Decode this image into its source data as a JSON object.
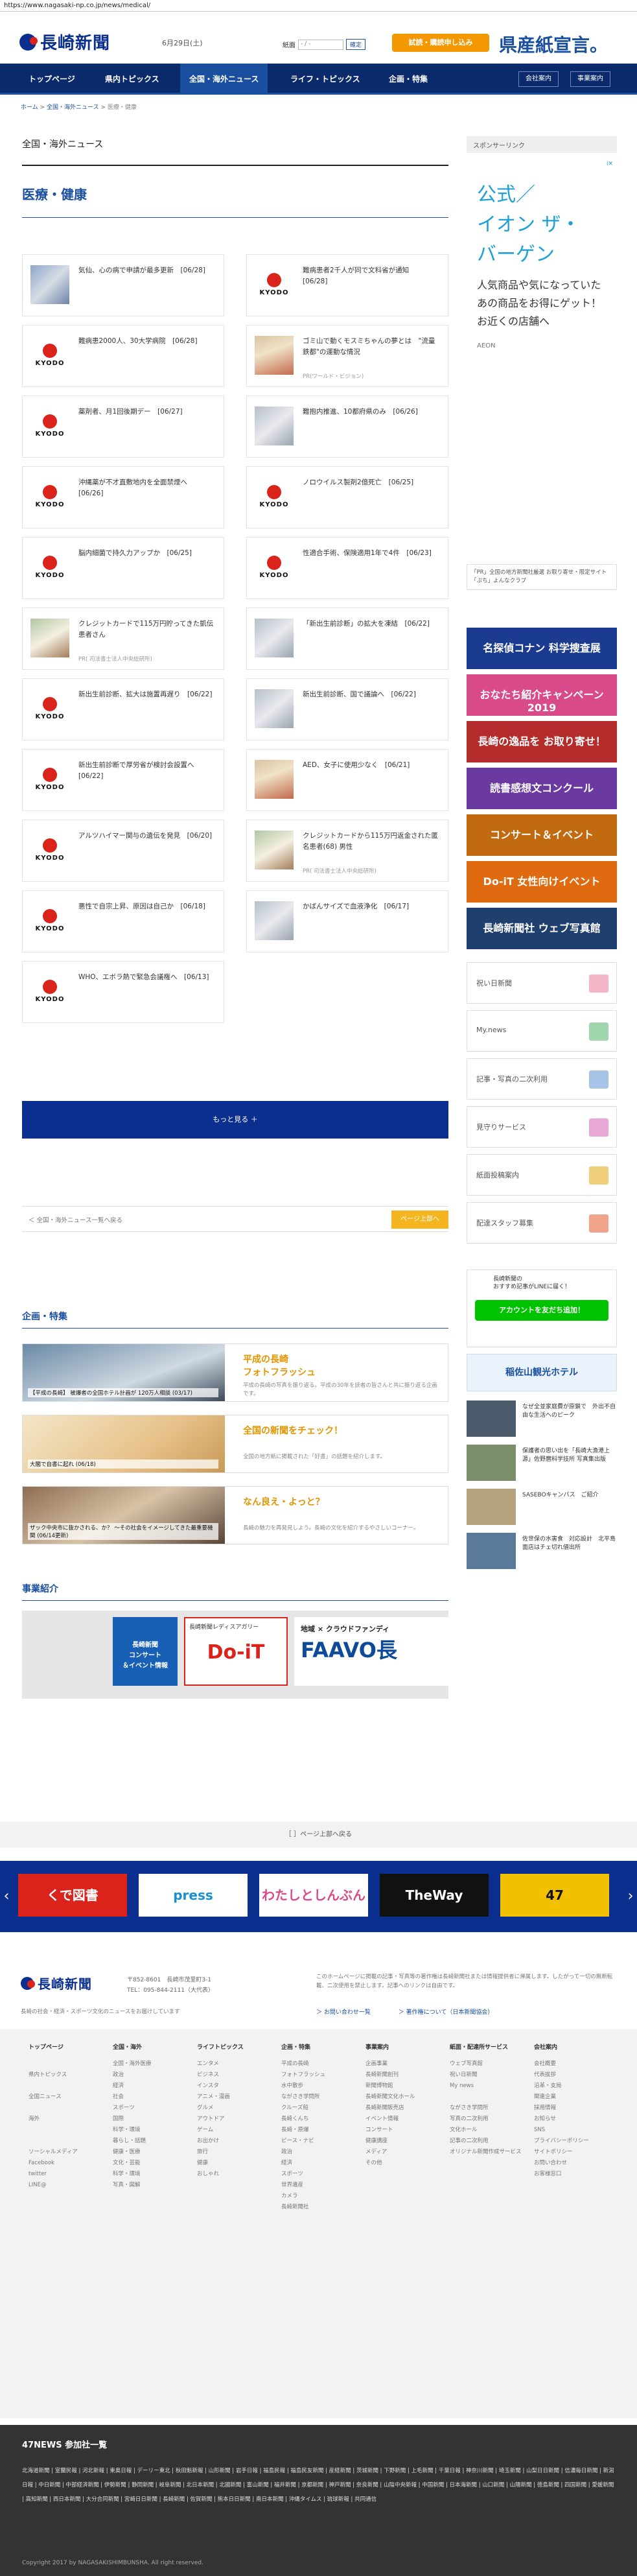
{
  "browser": {
    "url": "https://www.nagasaki-np.co.jp/news/medical/"
  },
  "header": {
    "logo": "長崎新聞",
    "date": "6月29日(土)",
    "date_label": "紙面",
    "date_placeholder": "- / -",
    "date_button": "確定",
    "trial_button": "試読・購読申し込み",
    "ad_text": "県産紙宣言。"
  },
  "nav": {
    "items": [
      "トップページ",
      "県内トピックス",
      "全国・海外ニュース",
      "ライフ・トピックス",
      "企画・特集"
    ],
    "right": [
      "会社案内",
      "事業案内"
    ]
  },
  "breadcrumb": {
    "home": "ホーム",
    "mid": "全国・海外ニュース",
    "current": "医療・健康",
    "sep": ">"
  },
  "section": {
    "title": "全国・海外ニュース",
    "sub": "医療・健康"
  },
  "articles": [
    {
      "title": "気仙、心の病で申請が最多更新　[06/28]",
      "thumb": "photo"
    },
    {
      "title": "難病患者2千人が同で文科省が通知　[06/28]",
      "thumb": "kyodo"
    },
    {
      "title": "難病患2000人、30大学病院　[06/28]",
      "thumb": "kyodo"
    },
    {
      "title": "ゴミ山で動くモスミちゃんの夢とは　\"流量鉄都\"の運動な情況",
      "pr": "PR(ワールド・ビジョン)",
      "thumb": "photo2"
    },
    {
      "title": "薬剤者、月1回後期デー　[06/27]",
      "thumb": "kyodo"
    },
    {
      "title": "難抱内推進、10都府県のみ　[06/26]",
      "thumb": "photo3"
    },
    {
      "title": "沖縄薬が不才直敷地内を全面禁煙へ　[06/26]",
      "thumb": "kyodo"
    },
    {
      "title": "ノロウイルス製剤2億死亡　[06/25]",
      "thumb": "kyodo"
    },
    {
      "title": "脳内細菌で持久力アップか　[06/25]",
      "thumb": "kyodo"
    },
    {
      "title": "性適合手術、保険適用1年で4件　[06/23]",
      "thumb": "kyodo"
    },
    {
      "title": "クレジットカードで115万円貯ってきた凱伝患者さん",
      "pr": "PR( 司法書士法人中央総研所)",
      "thumb": "photo4"
    },
    {
      "title": "「新出生前診断」の拡大を凍結　[06/22]",
      "thumb": "photo3"
    },
    {
      "title": "新出生前診断、拡大は施置再遅り　[06/22]",
      "thumb": "kyodo"
    },
    {
      "title": "新出生前診断、国で議論へ　[06/22]",
      "thumb": "photo3"
    },
    {
      "title": "新出生前診断で厚労省が検討会設置へ　[06/22]",
      "thumb": "kyodo"
    },
    {
      "title": "AED、女子に使用少なく　[06/21]",
      "thumb": "photo2"
    },
    {
      "title": "アルツハイマー関与の遺伝を発見　[06/20]",
      "thumb": "kyodo"
    },
    {
      "title": "クレジットカードから115万円返金された匿名患者(68) 男性",
      "pr": "PR( 司法書士法人中央総研所)",
      "thumb": "photo4"
    },
    {
      "title": "悪性で自宗上昇、原因は自己か　[06/18]",
      "thumb": "kyodo"
    },
    {
      "title": "かばんサイズで血液浄化　[06/17]",
      "thumb": "photo3"
    },
    {
      "title": "WHO、エボラ熱で緊急会議権へ　[06/13]",
      "thumb": "kyodo"
    }
  ],
  "kyodo_label": "KYODO",
  "more_button": "もっと見る ＋",
  "pager": {
    "back": "＜ 全国・海外ニュース一覧へ戻る",
    "top": "ページ上部へ"
  },
  "features": {
    "title": "企画・特集",
    "items": [
      {
        "cap": "【平成の長崎】 被爆者の全国ホテル計画が 120万人相談 (03/17)",
        "title": "平成の長崎\nフォトフラッシュ",
        "desc": "平成の長崎の写真を振り返る。平成の30年を読者の皆さんと共に振り返る企画です。"
      },
      {
        "cap": "大閣で自書に起れ (06/18)",
        "title": "全国の新聞をチェック！",
        "desc": "全国の地方紙に掲載された「好書」の話題を紹介します。"
      },
      {
        "cap": "ザック中央市に抜かされる、か？ 〜その社会をイメージしてきた最重要機関 (06/14更新)",
        "title": "なん良え・よっと？",
        "desc": "長崎の魅力を再発見しよう。長崎の文化を紹介するやさしいコーナー。"
      }
    ]
  },
  "business": {
    "title": "事業紹介",
    "b1": "長崎新聞\nコンサート\n＆イベント情報",
    "b2_head": "長崎新聞レディスアガリー",
    "b2_main": "Do-iT",
    "b3_head": "地域 × クラウドファンディ",
    "b3_main": "FAAVO長"
  },
  "sidebar": {
    "header": "スポンサーリンク",
    "ad_title": "公式／\nイオン ザ・\nバーゲン",
    "ad_sub": "人気商品や気になっていたあの商品をお得にゲット！お近くの店舗へ",
    "ad_brand": "AEON",
    "ad_badge": "i✕",
    "notice": "「PR」全国の地方新聞社厳選 お取り寄せ・限定サイト「ぷち」よんなクラブ",
    "banners": [
      {
        "text": "名探偵コナン 科学捜査展",
        "color": "#1a3b8f"
      },
      {
        "text": "おなたち紹介キャンペーン 2019",
        "color": "#d94a8a"
      },
      {
        "text": "長崎の逸品を お取り寄せ！",
        "color": "#b52c2c"
      },
      {
        "text": "読書感想文コンクール",
        "color": "#6b3aa0"
      },
      {
        "text": "コンサート＆イベント",
        "color": "#c26a10"
      },
      {
        "text": "Do-iT 女性向けイベント",
        "color": "#e06a10"
      },
      {
        "text": "長崎新聞社 ウェブ写真館",
        "color": "#1f3f6e"
      }
    ],
    "services": [
      {
        "label": "祝い日新聞",
        "color": "#f4b7c8"
      },
      {
        "label": "My.news",
        "color": "#9fd6ae"
      },
      {
        "label": "記事・写真の二次利用",
        "color": "#a7c3e6"
      },
      {
        "label": "見守りサービス",
        "color": "#e7a8d6"
      },
      {
        "label": "紙面投稿案内",
        "color": "#f0cf7a"
      },
      {
        "label": "配達スタッフ募集",
        "color": "#f2a48a"
      }
    ],
    "line_text": "長崎新聞の\nおすすめ記事がLINEに届く！",
    "line_button": "アカウントを友だち追加！",
    "hotel": "稲佐山観光ホテル",
    "side_news": [
      "なぜ全並家庭費が原鎖で　外出不自由な生活へのピーク",
      "保護者の思い出を「長崎大漁港上源」佐野麿科学技所 写真集出版",
      "SASEBOキャンパス　ご紹介",
      "佐世保の水害食　対応設計　北平島面店はチェ切れ値出所"
    ]
  },
  "page_top": "［ ］ページ上部へ戻る",
  "carousel": [
    "くで図書",
    "press",
    "わたしとしんぶん",
    "TheWay",
    "47"
  ],
  "footer": {
    "logo": "長崎新聞",
    "addr": "〒852-8601　長崎市茂里町3-1\nTEL：095-844-2111（大代表）",
    "desc": "長崎の社会・経済・スポーツ文化のニュースをお届けしています",
    "note": "このホームページに掲載の記事・写真等の著作権は長崎新聞社または情報提供者に帰属します。したがって一切の無断転載、二次使用を禁止します。記事へのリンクは自由です。",
    "link1": "＞ お問い合わせ一覧",
    "link2": "＞ 著作権について（日本新聞協会）"
  },
  "sitemap": [
    {
      "head": "トップページ",
      "items": [
        "",
        "県内トピックス",
        "",
        "全国ニュース",
        "",
        "海外",
        "",
        "",
        "ソーシャルメディア",
        "Facebook",
        "twitter",
        "LINE@"
      ]
    },
    {
      "head": "全国・海外",
      "items": [
        "全国・海外医療",
        "政治",
        "経済",
        "社会",
        "スポーツ",
        "国際",
        "科学・環境",
        "暮らし・話題",
        "健康・医療",
        "文化・芸能",
        "科学・環境",
        "写真・図解"
      ]
    },
    {
      "head": "ライフトピックス",
      "items": [
        "エンタメ",
        "ビジネス",
        "インスタ",
        "アニメ・漫画",
        "グルメ",
        "アウトドア",
        "ゲーム",
        "お出かけ",
        "旅行",
        "健康",
        "おしゃれ"
      ]
    },
    {
      "head": "企画・特集",
      "items": [
        "平成の長崎",
        "フォトフラッシュ",
        "水中散歩",
        "ながさき学問所",
        "クルーズ船",
        "長崎くんち",
        "長崎・原爆",
        "ピース・ナビ",
        "政治",
        "経済",
        "スポーツ",
        "世界遺産",
        "カメラ",
        "長崎新聞社"
      ]
    },
    {
      "head": "事業案内",
      "items": [
        "企画事業",
        "長崎新聞創刊",
        "新聞博物館",
        "長崎新聞文化ホール",
        "長崎新聞販売店",
        "イベント情報",
        "コンサート",
        "健康講座",
        "メディア",
        "その他"
      ]
    },
    {
      "head": "紙面・配達所サービス",
      "items": [
        "ウェブ写真館",
        "祝い日新聞",
        "My news",
        "",
        "ながさき学問所",
        "写真の二次利用",
        "文化ホール",
        "記事の二次利用",
        "オリジナル新聞作成サービス"
      ]
    },
    {
      "head": "会社案内",
      "items": [
        "会社概要",
        "代表挨拶",
        "沿革・支局",
        "関連企業",
        "採用情報",
        "お知らせ",
        "SNS",
        "プライバシーポリシー",
        "サイトポリシー",
        "お問い合わせ",
        "お客様窓口"
      ]
    }
  ],
  "news47": {
    "title": "47NEWS 参加社一覧",
    "list": "北海道新聞 | 室蘭民報 | 河北新報 | 東奥日報 | デーリー東北 | 秋田魁新報 | 山形新聞 | 岩手日報 | 福島民報 | 福島民友新聞 | 産経新聞 | 茨城新聞 | 下野新聞 | 上毛新聞 | 千葉日報 | 神奈川新聞 | 埼玉新聞 | 山梨日日新聞 | 信濃毎日新聞 | 新潟日報 | 中日新聞 | 中部経済新聞 | 伊勢新聞 | 静岡新聞 | 岐阜新聞 | 北日本新聞 | 北國新聞 | 富山新聞 | 福井新聞 | 京都新聞 | 神戸新聞 | 奈良新聞 | 山陰中央新報 | 中国新聞 | 日本海新聞 | 山口新聞 | 山陽新聞 | 徳島新聞 | 四国新聞 | 愛媛新聞 | 高知新聞 | 西日本新聞 | 大分合同新聞 | 宮崎日日新聞 | 長崎新聞 | 佐賀新聞 | 熊本日日新聞 | 南日本新聞 | 沖縄タイムス | 琉球新報 | 共同通信"
  },
  "copyright": "Copyright 2017 by NAGASAKISHIMBUNSHA. All right reserved."
}
